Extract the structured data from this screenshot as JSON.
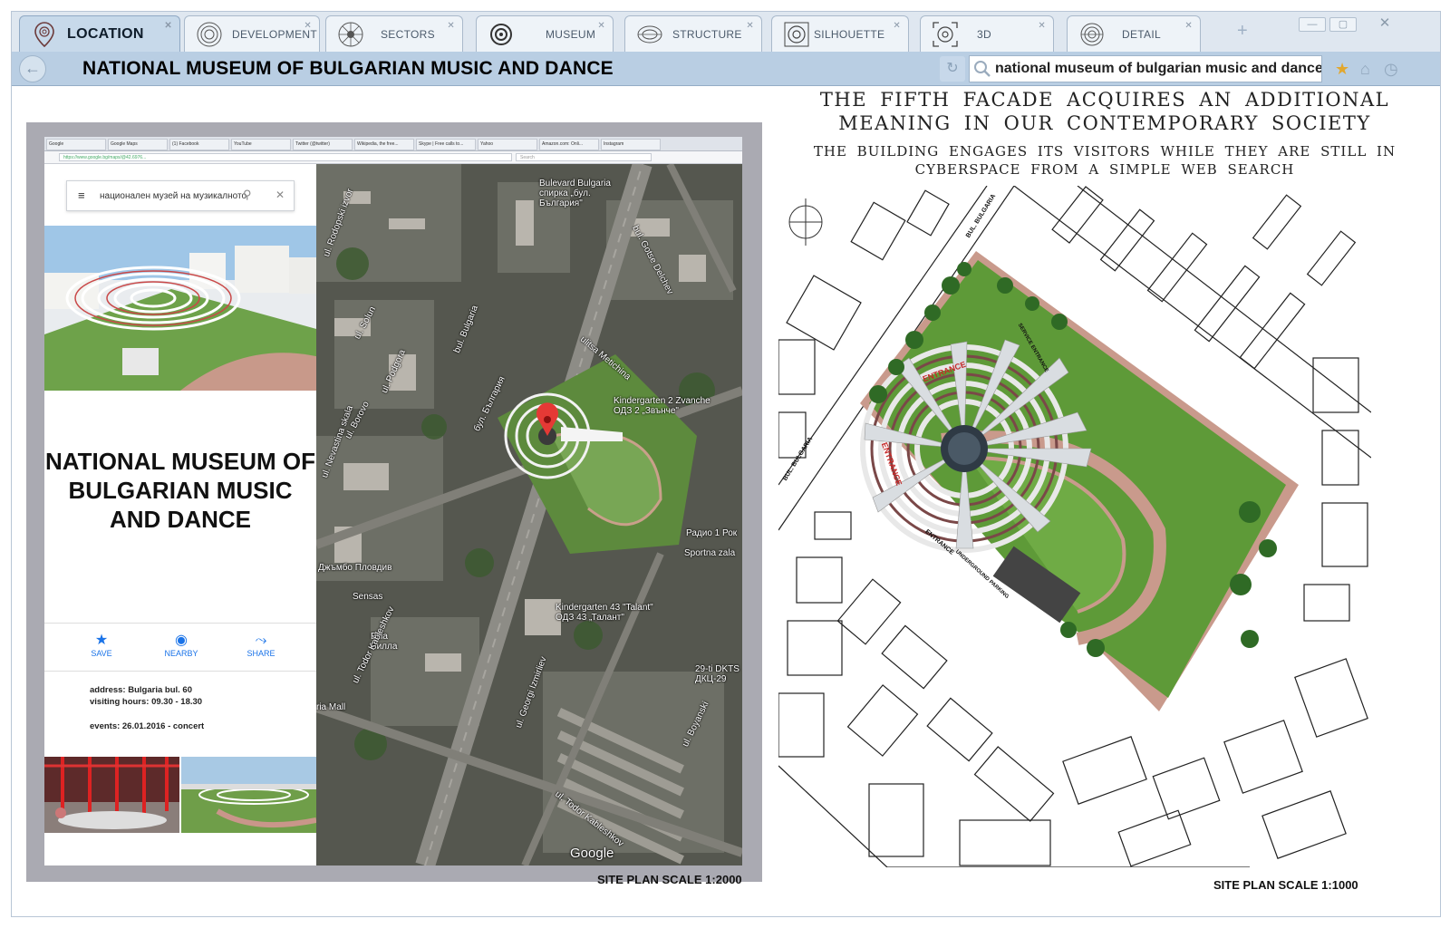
{
  "browser": {
    "tabs": [
      {
        "label": "LOCATION",
        "active": true,
        "icon": "fingerprint-pin-icon"
      },
      {
        "label": "DEVELOPMENT",
        "active": false,
        "icon": "concentric-rings-icon"
      },
      {
        "label": "SECTORS",
        "active": false,
        "icon": "radial-sectors-icon"
      },
      {
        "label": "MUSEUM",
        "active": false,
        "icon": "target-rings-icon"
      },
      {
        "label": "STRUCTURE",
        "active": false,
        "icon": "ring-structure-icon"
      },
      {
        "label": "SILHOUETTE",
        "active": false,
        "icon": "framed-rings-icon"
      },
      {
        "label": "3D",
        "active": false,
        "icon": "bracketed-rings-icon"
      },
      {
        "label": "DETAIL",
        "active": false,
        "icon": "rings-detail-icon"
      }
    ],
    "new_tab_label": "+",
    "window_buttons": [
      "—",
      "▢",
      "✕"
    ],
    "page_title": "NATIONAL MUSEUM OF BULGARIAN MUSIC AND DANCE",
    "search_value": "national museum of bulgarian music and dance"
  },
  "left_screenshot": {
    "tabs": [
      "Google",
      "Google Maps",
      "(1) Facebook",
      "YouTube",
      "Twitter (@twitter)",
      "Wikipedia, the free...",
      "Skype | Free calls to...",
      "Yahoo",
      "Amazon.com: Onli...",
      "Instagram"
    ],
    "url": "https://www.google.bg/maps/@42.6976...",
    "browser_search": "Search",
    "maps_query": "национален музей на музикалното",
    "museum_name": "NATIONAL MUSEUM OF BULGARIAN MUSIC AND DANCE",
    "actions": [
      {
        "label": "SAVE",
        "icon": "star-icon"
      },
      {
        "label": "NEARBY",
        "icon": "nearby-icon"
      },
      {
        "label": "SHARE",
        "icon": "share-icon"
      }
    ],
    "address": "address:  Bulgaria bul.  60",
    "hours": "visiting hours:  09.30 - 18.30",
    "events": "events:  26.01.2016 - concert",
    "map_labels": {
      "bus_stop": "Bulevard Bulgaria спирка „бул. България\"",
      "kindergarten2": "Kindergarten 2 Zvanche ОДЗ 2 „Звънче\"",
      "radio": "Радио 1 Рок",
      "sportna": "Sportna zala",
      "jumbo": "Джъмбо Пловдив",
      "sensas": "Sensas",
      "billa": "Billa Билла",
      "kindergarten43": "Kindergarten 43 \"Talant\" ОДЗ 43 „Талант\"",
      "dkts": "29-ti DKTS ДКЦ-29",
      "mall": "ria Mall",
      "google": "Google",
      "streets": [
        "bul. Bulgaria",
        "bul. Gotse Delchev",
        "ulitsa Metichina",
        "ul. Solun",
        "ul. Borovo",
        "ul. Rodopski izvor",
        "ul. Nevastina skala",
        "ul. Georgi Izmirliev",
        "ul. Todor Kableshkov",
        "ul. Boyanski",
        "Rodoposki izvor",
        "бул. България",
        "ul. Podgora"
      ]
    },
    "scale_label": "SITE PLAN    SCALE 1:2000"
  },
  "right_plan": {
    "headline": "THE FIFTH FACADE ACQUIRES AN ADDITIONAL MEANING IN OUR CONTEMPORARY SOCIETY",
    "subheadline": "THE BUILDING ENGAGES ITS VISITORS WHILE THEY ARE STILL IN CYBERSPACE FROM A SIMPLE WEB SEARCH",
    "labels": {
      "entrance_top": "ENTRANCE",
      "entrance_left": "ENTRANCE",
      "entrance_bottom": "ENTRANCE",
      "service_entrance": "SERVICE ENTRANCE",
      "parking": "UNDERGROUND PARKING",
      "street1": "BUL. BULGARIA",
      "street2": "BUL. BULGARIA"
    },
    "scale_label": "SITE PLAN    SCALE 1:1000"
  },
  "colors": {
    "tab_bg": "#eef3f8",
    "tab_active": "#c7d9ea",
    "nav_bg": "#b9cee3",
    "panel_gray": "#aaaab2",
    "grass": "#5f9a3a",
    "path": "#c98f86",
    "google_blue": "#1a73e8",
    "pin_red": "#e53935"
  }
}
